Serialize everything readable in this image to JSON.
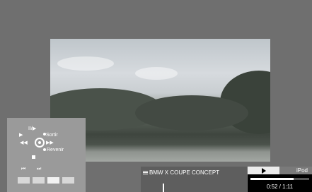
{
  "controls": {
    "play_pause": "II/▶",
    "exit_label": "Sortir",
    "back_label": "Revenir",
    "prev_icon": "⏮",
    "next_icon": "⏭"
  },
  "track": {
    "title": "BMW X COUPE CONCEPT"
  },
  "player": {
    "source": "iPod",
    "time": "0:52 / 1:11",
    "progress": 0.73
  },
  "colors": {
    "panel": "#9a9a9a",
    "player": "#000000",
    "track_bar": "#5e5e5e"
  }
}
